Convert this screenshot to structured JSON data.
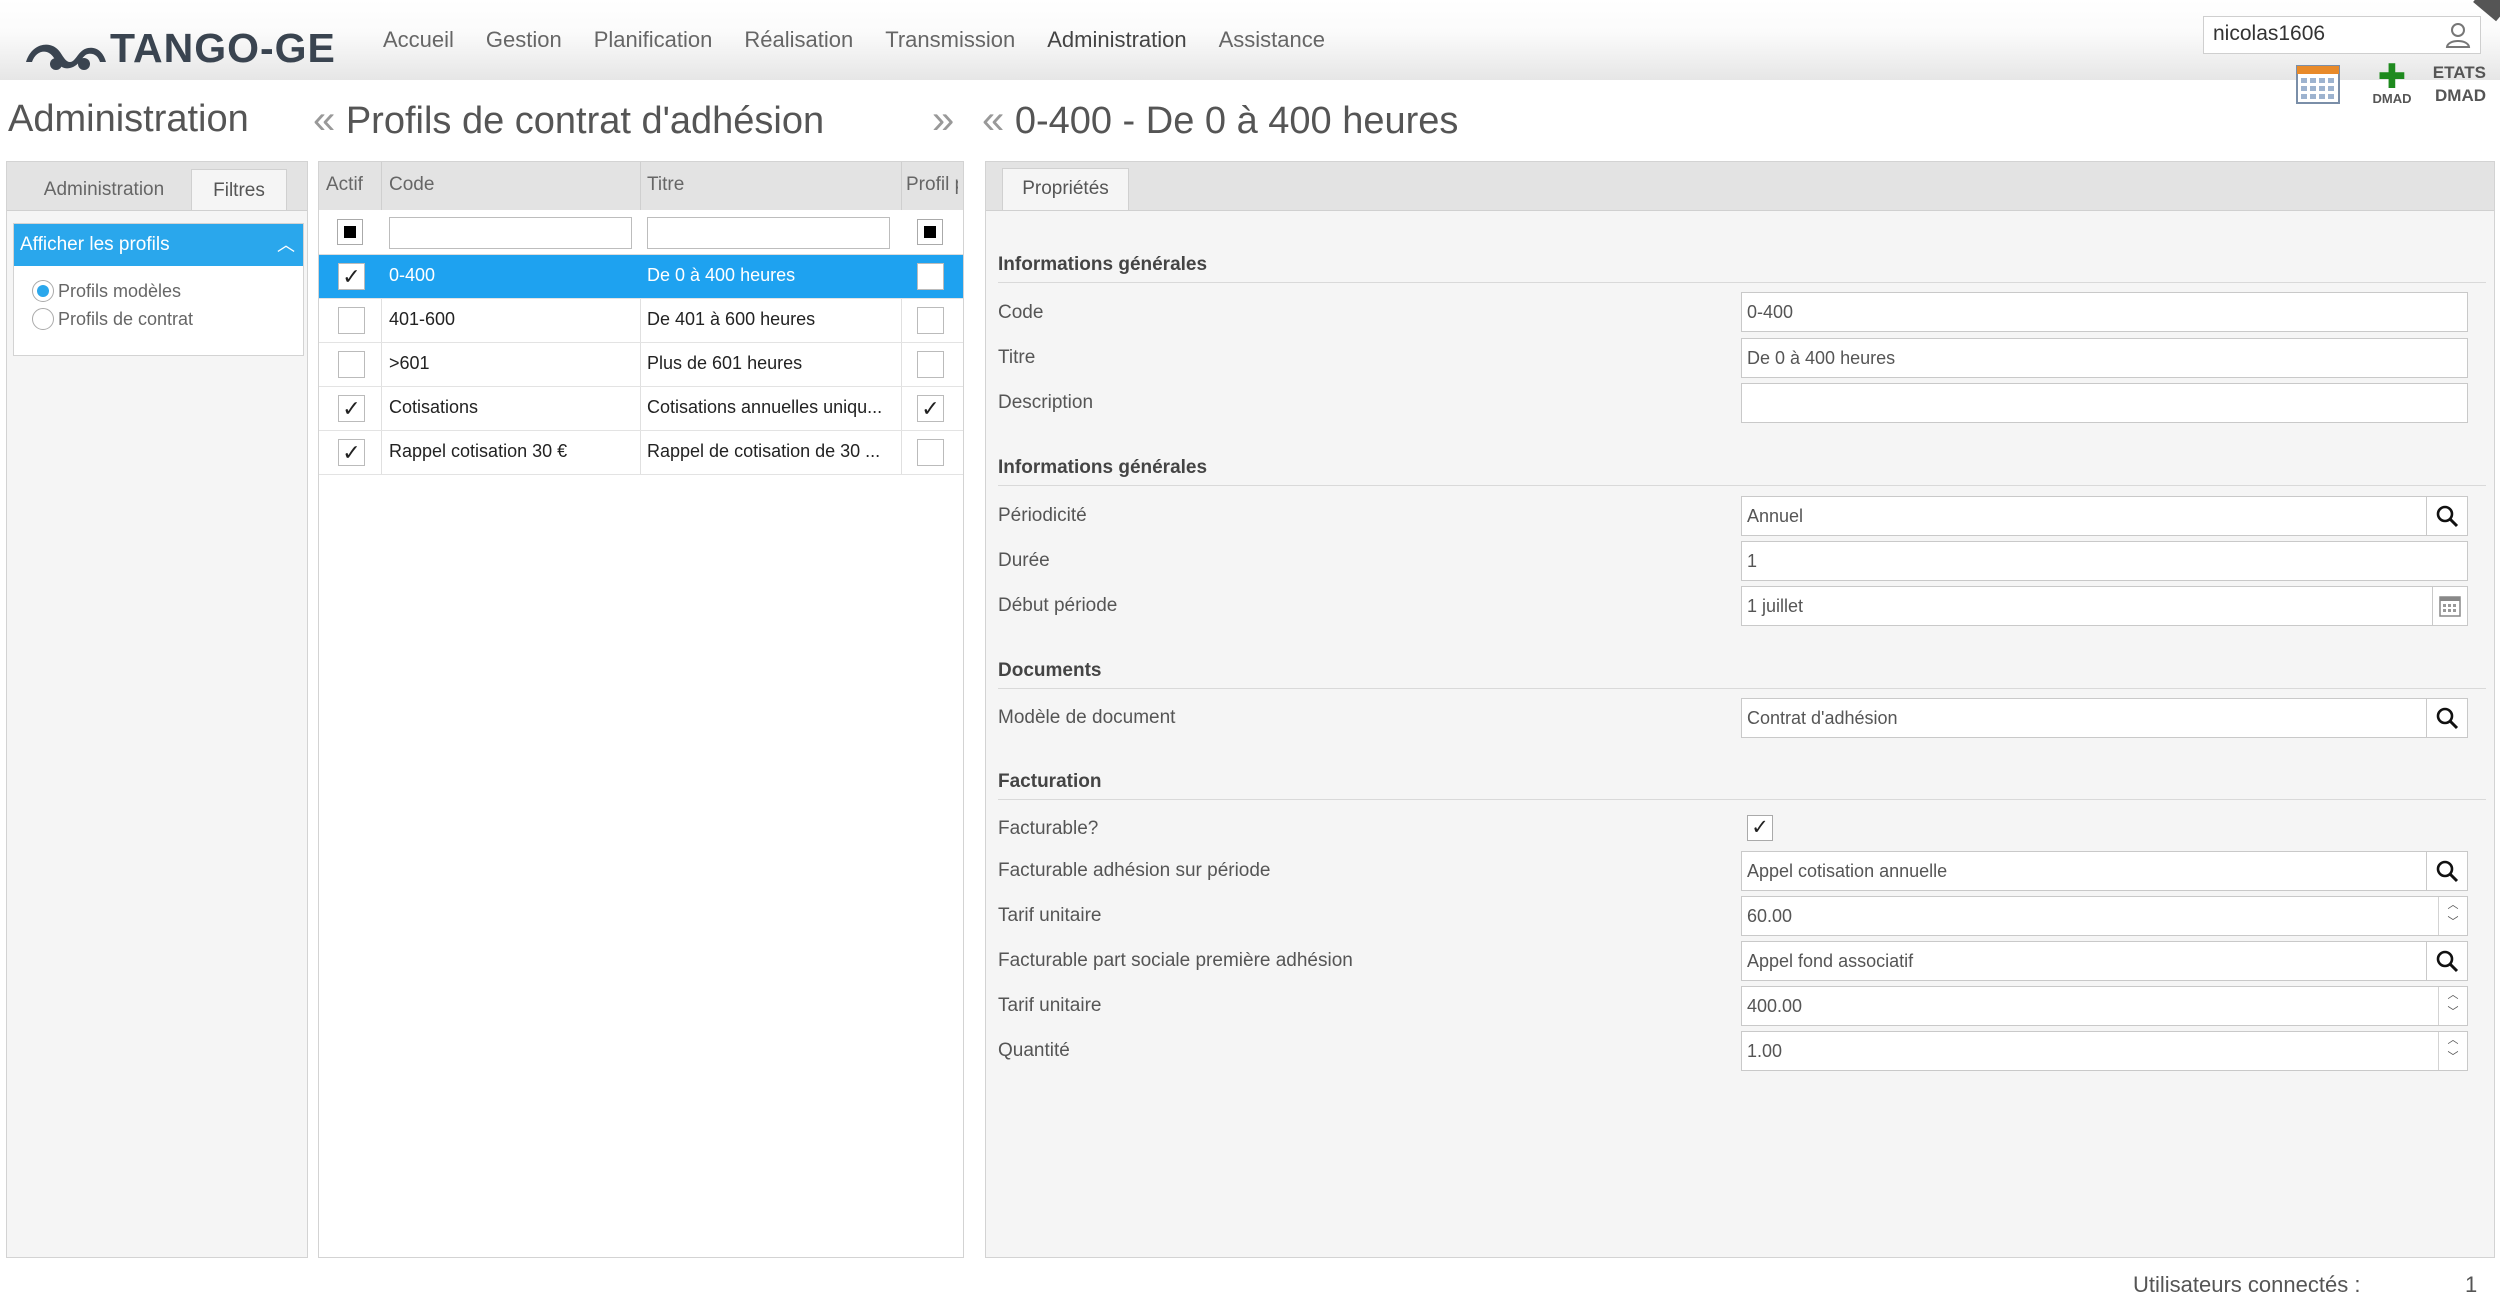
{
  "app": {
    "logo_text": "TANGO-GE"
  },
  "nav": [
    "Accueil",
    "Gestion",
    "Planification",
    "Réalisation",
    "Transmission",
    "Administration",
    "Assistance"
  ],
  "user": {
    "value": "nicolas1606"
  },
  "tools": {
    "dmad_label": "DMAD",
    "etats_line1": "ETATS",
    "etats_line2": "DMAD"
  },
  "titles": {
    "left": "Administration",
    "middle": "Profils de contrat d'adhésion",
    "right": "0-400 - De 0 à 400 heures"
  },
  "left_panel": {
    "tabs": [
      "Administration",
      "Filtres"
    ],
    "filter_header": "Afficher les profils",
    "options": [
      "Profils modèles",
      "Profils de contrat"
    ]
  },
  "grid": {
    "headers": {
      "actif": "Actif",
      "code": "Code",
      "titre": "Titre",
      "profil": "Profil par..."
    },
    "rows": [
      {
        "actif": true,
        "code": "0-400",
        "titre": "De 0 à 400 heures",
        "profil": false
      },
      {
        "actif": false,
        "code": "401-600",
        "titre": "De 401 à 600 heures",
        "profil": false
      },
      {
        "actif": false,
        "code": ">601",
        "titre": "Plus de 601 heures",
        "profil": false
      },
      {
        "actif": true,
        "code": "Cotisations",
        "titre": "Cotisations annuelles uniqu...",
        "profil": true
      },
      {
        "actif": true,
        "code": "Rappel cotisation 30 €",
        "titre": "Rappel de cotisation de 30 ...",
        "profil": false
      }
    ]
  },
  "properties": {
    "tab": "Propriétés",
    "sections": {
      "general1": "Informations générales",
      "general2": "Informations générales",
      "documents": "Documents",
      "facturation": "Facturation"
    },
    "code": {
      "label": "Code",
      "value": "0-400"
    },
    "titre": {
      "label": "Titre",
      "value": "De 0 à 400 heures"
    },
    "description": {
      "label": "Description",
      "value": ""
    },
    "periodicite": {
      "label": "Périodicité",
      "value": "Annuel"
    },
    "duree": {
      "label": "Durée",
      "value": "1"
    },
    "debut": {
      "label": "Début période",
      "value": "1 juillet"
    },
    "modele": {
      "label": "Modèle de document",
      "value": "Contrat d'adhésion"
    },
    "facturable": {
      "label": "Facturable?",
      "checked": true
    },
    "fact_periode": {
      "label": "Facturable adhésion sur période",
      "value": "Appel cotisation annuelle"
    },
    "tarif1": {
      "label": "Tarif unitaire",
      "value": "60.00"
    },
    "fact_part": {
      "label": "Facturable part sociale première adhésion",
      "value": "Appel fond associatif"
    },
    "tarif2": {
      "label": "Tarif unitaire",
      "value": "400.00"
    },
    "quantite": {
      "label": "Quantité",
      "value": "1.00"
    }
  },
  "footer": {
    "label": "Utilisateurs connectés :",
    "count": "1"
  },
  "colors": {
    "accent": "#2aa7ec",
    "selected_row": "#1ea2f0",
    "dmad_green": "#1e8a1e"
  }
}
